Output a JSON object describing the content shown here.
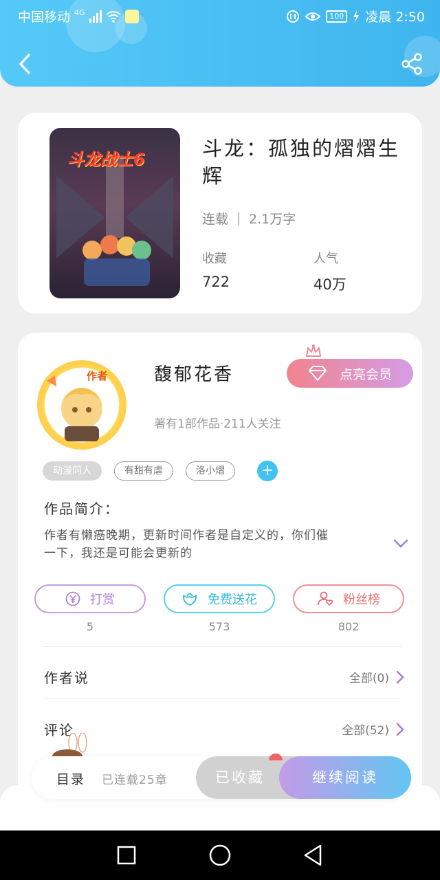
{
  "status_bar": {
    "carrier": "中国移动",
    "network": "4G",
    "battery": "100",
    "time": "凌晨 2:50"
  },
  "header": {
    "back_icon": "back-arrow-icon",
    "share_icon": "share-icon",
    "color_start": "#55c9f7",
    "color_end": "#3fb5ef"
  },
  "book": {
    "title": "斗龙：孤独的熠熠生辉",
    "status": "连载",
    "word_count": "2.1万字",
    "collect_label": "收藏",
    "collect_value": "722",
    "popularity_label": "人气",
    "popularity_value": "40万",
    "cover_logo": "斗龙战士6"
  },
  "author": {
    "badge": "作者",
    "name": "馥郁花香",
    "meta": "著有1部作品·211人关注",
    "vip_label": "点亮会员",
    "tags": [
      "动漫同人",
      "有甜有虐",
      "洛小熠"
    ],
    "intro_title": "作品简介：",
    "intro_text": "作者有懒癌晚期，更新时间作者是自定义的，你们催一下，我还是可能会更新的"
  },
  "actions": {
    "reward_label": "打赏",
    "reward_count": "5",
    "flower_label": "免费送花",
    "flower_count": "573",
    "fans_label": "粉丝榜",
    "fans_count": "802"
  },
  "sections": {
    "author_says_title": "作者说",
    "author_says_link": "全部(0)",
    "comments_title": "评论",
    "comments_link": "全部(52)"
  },
  "bottom_bar": {
    "toc_label": "目录",
    "chapters_label": "已连载25章",
    "favorited_label": "已收藏",
    "continue_label": "继续阅读"
  },
  "colors": {
    "accent_blue": "#41c2f0",
    "vip_pink": "#f0848e",
    "vip_purple": "#d49ce6"
  }
}
